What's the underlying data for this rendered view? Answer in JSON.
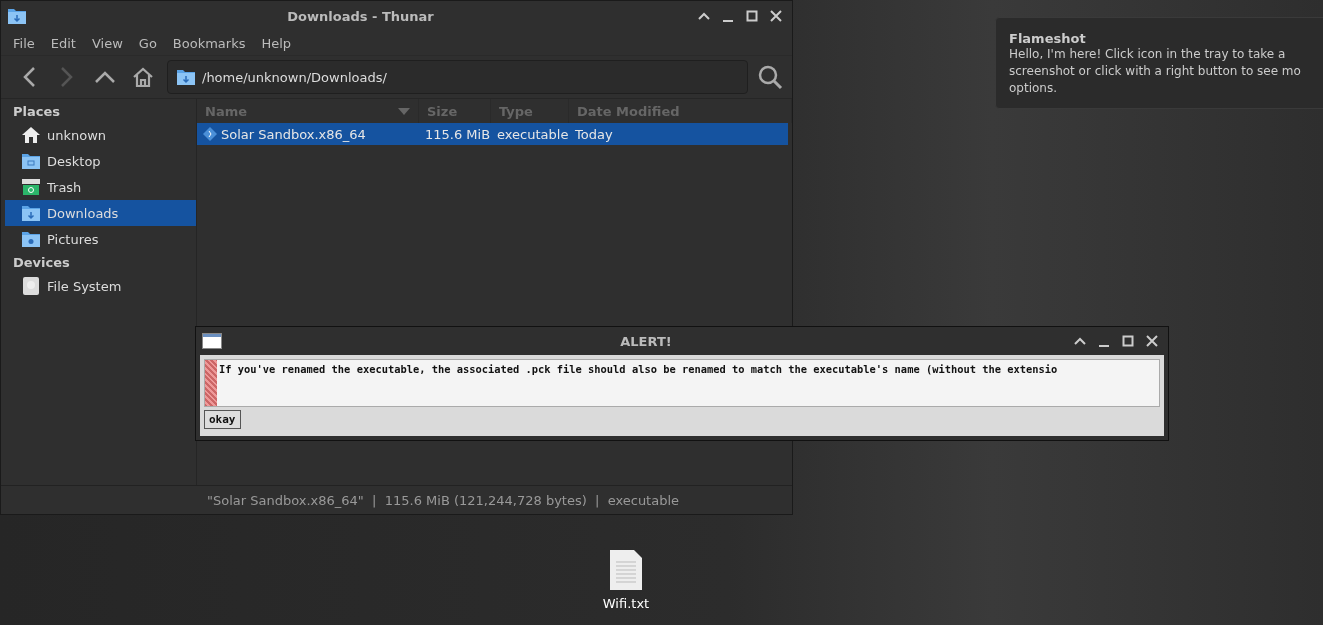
{
  "file_manager": {
    "title": "Downloads - Thunar",
    "menu": [
      "File",
      "Edit",
      "View",
      "Go",
      "Bookmarks",
      "Help"
    ],
    "path": "/home/unknown/Downloads/",
    "sidebar": [
      {
        "heading": "Places",
        "items": [
          {
            "label": "unknown",
            "kind": "home",
            "selected": false
          },
          {
            "label": "Desktop",
            "kind": "desktop",
            "selected": false
          },
          {
            "label": "Trash",
            "kind": "trash",
            "selected": false
          },
          {
            "label": "Downloads",
            "kind": "downloads",
            "selected": true
          },
          {
            "label": "Pictures",
            "kind": "pictures",
            "selected": false
          }
        ]
      },
      {
        "heading": "Devices",
        "items": [
          {
            "label": "File System",
            "kind": "drive",
            "selected": false
          }
        ]
      }
    ],
    "columns": [
      "Name",
      "Size",
      "Type",
      "Date Modified"
    ],
    "rows": [
      {
        "name": "Solar Sandbox.x86_64",
        "size": "115.6 MiB",
        "type": "executable",
        "date": "Today",
        "selected": true
      }
    ],
    "status_bar": "\"Solar Sandbox.x86_64\"  |  115.6 MiB (121,244,728 bytes)  |  executable"
  },
  "alert": {
    "title": "ALERT!",
    "message": "If you've renamed the executable, the associated .pck file should also be renamed to match the executable's name (without the extensio",
    "button": "okay"
  },
  "notification": {
    "title": "Flameshot",
    "body": "Hello, I'm here! Click icon in the tray to take a screenshot or click with a right button to see mo options."
  },
  "desktop_icons": [
    {
      "label": "Wifi.txt"
    }
  ]
}
